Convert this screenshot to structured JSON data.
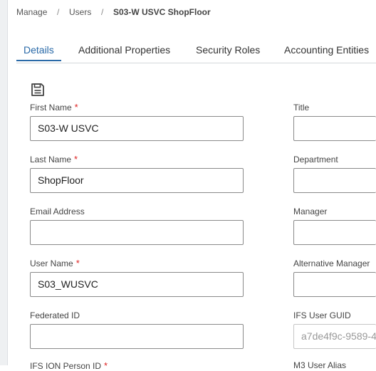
{
  "breadcrumb": {
    "items": [
      "Manage",
      "Users"
    ],
    "separator": "/",
    "current": "S03-W USVC ShopFloor"
  },
  "tabs": [
    "Details",
    "Additional Properties",
    "Security Roles",
    "Accounting Entities"
  ],
  "active_tab": "Details",
  "toolbar": {
    "save_icon": "save-icon"
  },
  "form": {
    "required_marker": "*",
    "first_name": {
      "label": "First Name",
      "value": "S03-W USVC"
    },
    "last_name": {
      "label": "Last Name",
      "value": "ShopFloor"
    },
    "email": {
      "label": "Email Address",
      "value": ""
    },
    "user_name": {
      "label": "User Name",
      "value": "S03_WUSVC"
    },
    "federated_id": {
      "label": "Federated ID",
      "value": ""
    },
    "ion_person_id": {
      "label": "IFS ION Person ID"
    },
    "title": {
      "label": "Title",
      "value": ""
    },
    "department": {
      "label": "Department",
      "value": ""
    },
    "manager": {
      "label": "Manager",
      "value": ""
    },
    "alt_manager": {
      "label": "Alternative Manager",
      "value": ""
    },
    "user_guid": {
      "label": "IFS User GUID",
      "value": "a7de4f9c-9589-4"
    },
    "m3_alias": {
      "label": "M3 User Alias"
    }
  },
  "colors": {
    "accent": "#2a6aa8",
    "required": "#dd2222"
  }
}
